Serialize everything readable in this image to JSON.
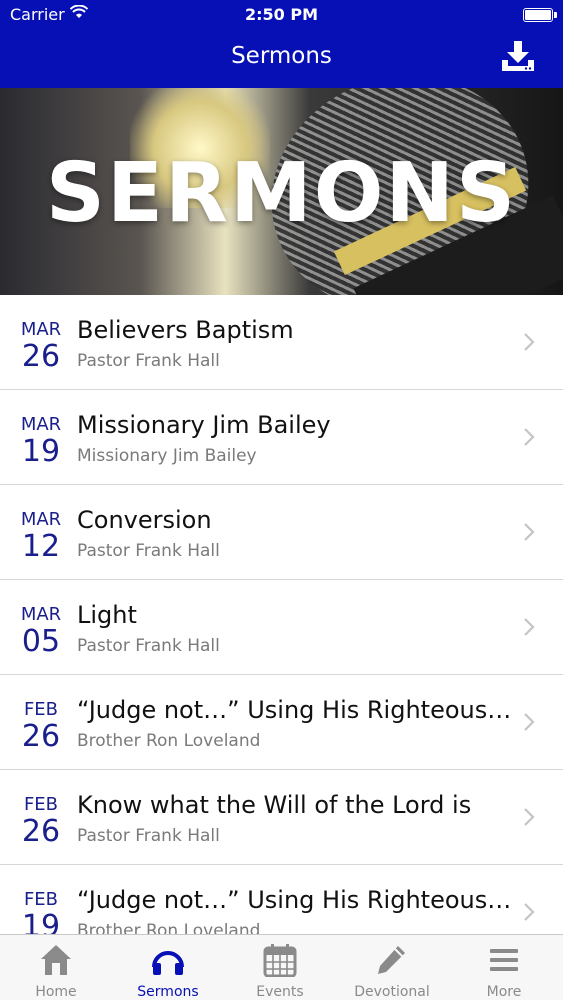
{
  "status": {
    "carrier": "Carrier",
    "time": "2:50 PM"
  },
  "nav": {
    "title": "Sermons"
  },
  "banner": {
    "title": "SERMONS"
  },
  "sermons": [
    {
      "month": "MAR",
      "day": "26",
      "title": "Believers Baptism",
      "speaker": "Pastor Frank Hall"
    },
    {
      "month": "MAR",
      "day": "19",
      "title": "Missionary Jim Bailey",
      "speaker": "Missionary Jim Bailey"
    },
    {
      "month": "MAR",
      "day": "12",
      "title": "Conversion",
      "speaker": "Pastor Frank Hall"
    },
    {
      "month": "MAR",
      "day": "05",
      "title": "Light",
      "speaker": "Pastor Frank Hall"
    },
    {
      "month": "FEB",
      "day": "26",
      "title": "“Judge not…” Using His Righteous Judgement",
      "speaker": "Brother Ron Loveland"
    },
    {
      "month": "FEB",
      "day": "26",
      "title": "Know what the Will of the Lord is",
      "speaker": "Pastor Frank Hall"
    },
    {
      "month": "FEB",
      "day": "19",
      "title": "“Judge not…” Using His Righteous Judgement",
      "speaker": "Brother Ron Loveland"
    }
  ],
  "tabs": [
    {
      "label": "Home",
      "icon": "home-icon"
    },
    {
      "label": "Sermons",
      "icon": "headphones-icon"
    },
    {
      "label": "Events",
      "icon": "calendar-icon"
    },
    {
      "label": "Devotional",
      "icon": "pencil-icon"
    },
    {
      "label": "More",
      "icon": "menu-icon"
    }
  ],
  "colors": {
    "accent": "#0710b4",
    "date": "#1a1f8c",
    "tab_inactive": "#8a8a8a"
  }
}
